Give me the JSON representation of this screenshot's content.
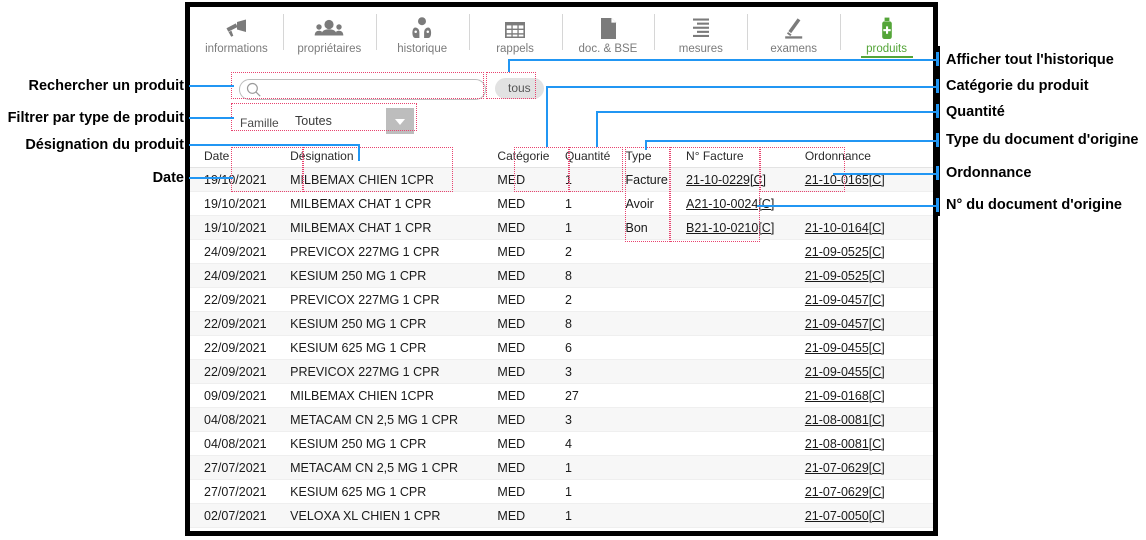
{
  "window": {
    "tabs": [
      {
        "id": "informations",
        "label": "informations",
        "icon": "megaphone-icon",
        "active": false
      },
      {
        "id": "proprietaires",
        "label": "propriétaires",
        "icon": "people-icon",
        "active": false
      },
      {
        "id": "historique",
        "label": "historique",
        "icon": "pets-icon",
        "active": false
      },
      {
        "id": "rappels",
        "label": "rappels",
        "icon": "calendar-icon",
        "active": false
      },
      {
        "id": "docbse",
        "label": "doc. & BSE",
        "icon": "document-icon",
        "active": false
      },
      {
        "id": "mesures",
        "label": "mesures",
        "icon": "ruler-icon",
        "active": false
      },
      {
        "id": "examens",
        "label": "examens",
        "icon": "microscope-icon",
        "active": false
      },
      {
        "id": "produits",
        "label": "produits",
        "icon": "bottle-icon",
        "active": true
      }
    ],
    "accent_color": "#54a538"
  },
  "search": {
    "icon": "search-icon",
    "value": "",
    "placeholder": "",
    "all_button_label": "tous"
  },
  "filter": {
    "label": "Famille",
    "value": "Toutes",
    "arrow_icon": "chevron-down-icon"
  },
  "table": {
    "columns": [
      {
        "key": "date",
        "label": "Date"
      },
      {
        "key": "designation",
        "label": "Désignation"
      },
      {
        "key": "categorie",
        "label": "Catégorie"
      },
      {
        "key": "quantite",
        "label": "Quantité"
      },
      {
        "key": "type",
        "label": "Type"
      },
      {
        "key": "facture",
        "label": "N° Facture"
      },
      {
        "key": "ordonnance",
        "label": "Ordonnance"
      }
    ],
    "rows": [
      {
        "date": "19/10/2021",
        "designation": "MILBEMAX CHIEN 1CPR",
        "categorie": "MED",
        "quantite": "1",
        "type": "Facture",
        "facture": "21-10-0229[C]",
        "ordonnance": "21-10-0165[C]"
      },
      {
        "date": "19/10/2021",
        "designation": "MILBEMAX CHAT 1 CPR",
        "categorie": "MED",
        "quantite": "1",
        "type": "Avoir",
        "facture": "A21-10-0024[C]",
        "ordonnance": ""
      },
      {
        "date": "19/10/2021",
        "designation": "MILBEMAX CHAT 1 CPR",
        "categorie": "MED",
        "quantite": "1",
        "type": "Bon",
        "facture": "B21-10-0210[C]",
        "ordonnance": "21-10-0164[C]"
      },
      {
        "date": "24/09/2021",
        "designation": "PREVICOX 227MG 1 CPR",
        "categorie": "MED",
        "quantite": "2",
        "type": "",
        "facture": "",
        "ordonnance": "21-09-0525[C]"
      },
      {
        "date": "24/09/2021",
        "designation": "KESIUM 250 MG 1 CPR",
        "categorie": "MED",
        "quantite": "8",
        "type": "",
        "facture": "",
        "ordonnance": "21-09-0525[C]"
      },
      {
        "date": "22/09/2021",
        "designation": "PREVICOX 227MG 1 CPR",
        "categorie": "MED",
        "quantite": "2",
        "type": "",
        "facture": "",
        "ordonnance": "21-09-0457[C]"
      },
      {
        "date": "22/09/2021",
        "designation": "KESIUM 250 MG 1 CPR",
        "categorie": "MED",
        "quantite": "8",
        "type": "",
        "facture": "",
        "ordonnance": "21-09-0457[C]"
      },
      {
        "date": "22/09/2021",
        "designation": "KESIUM 625 MG 1 CPR",
        "categorie": "MED",
        "quantite": "6",
        "type": "",
        "facture": "",
        "ordonnance": "21-09-0455[C]"
      },
      {
        "date": "22/09/2021",
        "designation": "PREVICOX 227MG 1 CPR",
        "categorie": "MED",
        "quantite": "3",
        "type": "",
        "facture": "",
        "ordonnance": "21-09-0455[C]"
      },
      {
        "date": "09/09/2021",
        "designation": "MILBEMAX CHIEN 1CPR",
        "categorie": "MED",
        "quantite": "27",
        "type": "",
        "facture": "",
        "ordonnance": "21-09-0168[C]"
      },
      {
        "date": "04/08/2021",
        "designation": "METACAM CN 2,5 MG 1 CPR",
        "categorie": "MED",
        "quantite": "3",
        "type": "",
        "facture": "",
        "ordonnance": "21-08-0081[C]"
      },
      {
        "date": "04/08/2021",
        "designation": "KESIUM 250 MG 1 CPR",
        "categorie": "MED",
        "quantite": "4",
        "type": "",
        "facture": "",
        "ordonnance": "21-08-0081[C]"
      },
      {
        "date": "27/07/2021",
        "designation": "METACAM CN 2,5 MG 1 CPR",
        "categorie": "MED",
        "quantite": "1",
        "type": "",
        "facture": "",
        "ordonnance": "21-07-0629[C]"
      },
      {
        "date": "27/07/2021",
        "designation": "KESIUM 625 MG 1 CPR",
        "categorie": "MED",
        "quantite": "1",
        "type": "",
        "facture": "",
        "ordonnance": "21-07-0629[C]"
      },
      {
        "date": "02/07/2021",
        "designation": "VELOXA XL CHIEN 1 CPR",
        "categorie": "MED",
        "quantite": "1",
        "type": "",
        "facture": "",
        "ordonnance": "21-07-0050[C]"
      }
    ]
  },
  "annotations": {
    "left": [
      {
        "id": "rechercher",
        "text": "Rechercher un produit"
      },
      {
        "id": "filtrer",
        "text": "Filtrer par type de produit"
      },
      {
        "id": "designation",
        "text": "Désignation du produit"
      },
      {
        "id": "date",
        "text": "Date"
      }
    ],
    "right": [
      {
        "id": "afficher-tout",
        "text": "Afficher tout l'historique"
      },
      {
        "id": "categorie",
        "text": "Catégorie du produit"
      },
      {
        "id": "quantite",
        "text": "Quantité"
      },
      {
        "id": "type-doc",
        "text": "Type du document d'origine"
      },
      {
        "id": "ordonnance",
        "text": "Ordonnance"
      },
      {
        "id": "num-doc",
        "text": "N° du document d'origine"
      }
    ],
    "callout_color": "#2196f3",
    "highlight_color": "#e8436f",
    "bar_color": "#000000"
  }
}
